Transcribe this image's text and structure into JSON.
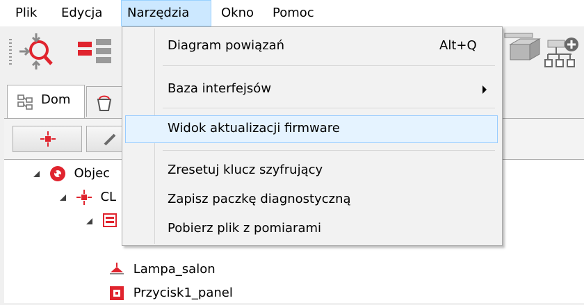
{
  "menubar": {
    "items": [
      {
        "label": "Plik"
      },
      {
        "label": "Edycja"
      },
      {
        "label": "Narzędzia",
        "active": true
      },
      {
        "label": "Okno"
      },
      {
        "label": "Pomoc"
      }
    ]
  },
  "toolbar": {
    "buttons": [
      {
        "icon": "search-move-icon"
      },
      {
        "icon": "flow-icon"
      },
      {
        "icon": "network-box-icon"
      },
      {
        "icon": "add-hierarchy-icon"
      }
    ]
  },
  "tabs": [
    {
      "label": "Dom",
      "icon": "home-tree-icon",
      "selected": true
    },
    {
      "label": "",
      "icon": "bucket-icon",
      "selected": false
    }
  ],
  "tree": {
    "rows": [
      {
        "label": "Objec",
        "icon": "object-icon"
      },
      {
        "label": "CL",
        "icon": "module-icon"
      },
      {
        "label": "",
        "icon": "panel-icon"
      },
      {
        "label": "Lampa_salon",
        "icon": "lamp-icon"
      },
      {
        "label": "Przycisk1_panel",
        "icon": "button-icon"
      }
    ]
  },
  "dropdown": {
    "items": [
      {
        "label": "Diagram powiązań",
        "accelerator": "Alt+Q"
      },
      {
        "label": "Baza interfejsów",
        "submenu": true
      },
      {
        "label": "Widok aktualizacji firmware",
        "highlighted": true
      },
      {
        "label": "Zresetuj klucz szyfrujący"
      },
      {
        "label": "Zapisz paczkę diagnostyczną"
      },
      {
        "label": "Pobierz plik z pomiarami"
      }
    ]
  },
  "colors": {
    "menu_highlight": "#cce8ff",
    "item_highlight": "#e5f3ff",
    "highlight_border": "#99ccff",
    "accent_red": "#e0242e"
  }
}
